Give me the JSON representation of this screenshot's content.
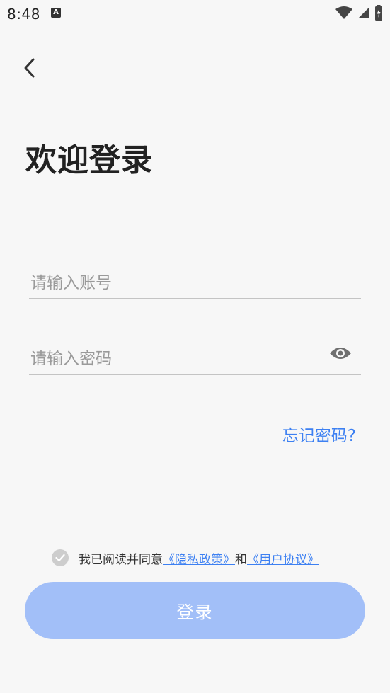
{
  "status_bar": {
    "time": "8:48",
    "a_icon_letter": "A",
    "icons": [
      "wifi-icon",
      "signal-icon",
      "battery-icon"
    ]
  },
  "header": {
    "back_icon": "chevron-left-icon"
  },
  "title": "欢迎登录",
  "account_field": {
    "value": "",
    "placeholder": "请输入账号"
  },
  "password_field": {
    "value": "",
    "placeholder": "请输入密码",
    "toggle_icon": "eye-icon"
  },
  "forgot_password": "忘记密码?",
  "agreement": {
    "checked": true,
    "prefix": "我已阅读并同意",
    "privacy_link": "《隐私政策》",
    "and": "和",
    "terms_link": "《用户协议》"
  },
  "login_button": {
    "label": "登录",
    "enabled": false
  },
  "colors": {
    "background": "#f7f7f7",
    "accent": "#3d80f2",
    "button_disabled": "#a2bff8",
    "text_primary": "#222222",
    "placeholder": "#9a9a9a",
    "divider": "#c4c4c4",
    "check_bg": "#cdcdcd"
  }
}
